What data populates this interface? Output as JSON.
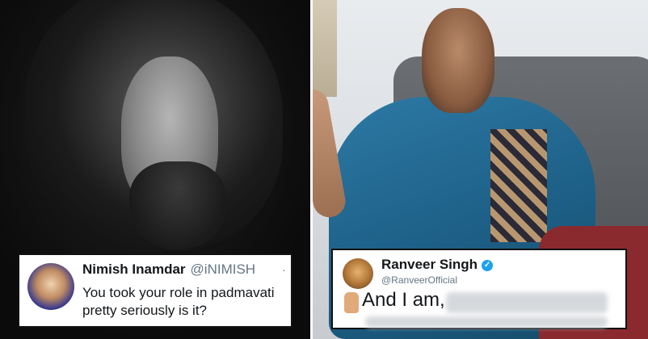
{
  "colors": {
    "verified_blue": "#1da1f2",
    "handle_gray": "#657786",
    "text_dark": "#14171a"
  },
  "tweets": {
    "left": {
      "display_name": "Nimish Inamdar",
      "handle": "@iNIMISH",
      "more_glyph": "·",
      "text": "You took your role in padmavati pretty seriously is it?"
    },
    "right": {
      "display_name": "Ranveer Singh",
      "verified_glyph": "✓",
      "handle": "@RanveerOfficial",
      "text": "And I am,"
    }
  }
}
